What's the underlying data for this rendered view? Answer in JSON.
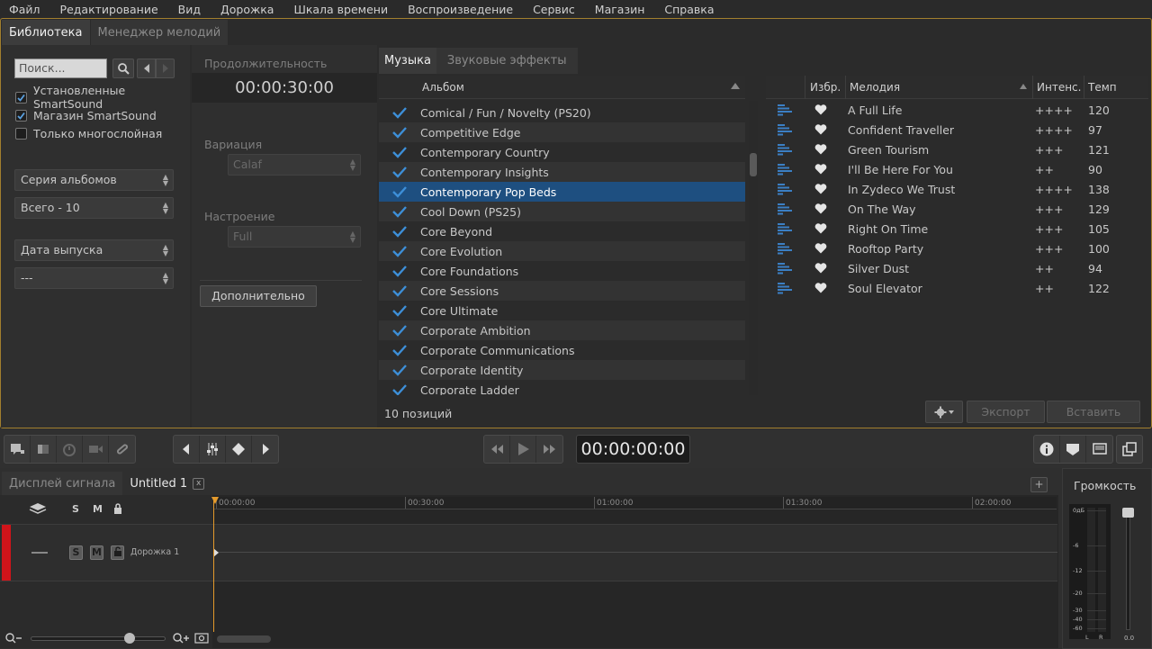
{
  "menu": [
    "Файл",
    "Редактирование",
    "Вид",
    "Дорожка",
    "Шкала времени",
    "Воспроизведение",
    "Сервис",
    "Магазин",
    "Справка"
  ],
  "library_tabs": {
    "library": "Библиотека",
    "melody_manager": "Менеджер мелодий"
  },
  "filters": {
    "search_placeholder": "Поиск...",
    "installed": "Установленные SmartSound",
    "store": "Магазин SmartSound",
    "multilayer_only": "Только многослойная",
    "series": "Серия альбомов",
    "total": "Всего - 10",
    "release_date": "Дата выпуска",
    "dash": "---"
  },
  "details": {
    "duration_label": "Продолжительность",
    "duration_value": "00:00:30:00",
    "variation_label": "Вариация",
    "variation_value": "Calaf",
    "mood_label": "Настроение",
    "mood_value": "Full",
    "more_button": "Дополнительно"
  },
  "music_tabs": {
    "music": "Музыка",
    "sfx": "Звуковые эффекты"
  },
  "album_header": "Альбом",
  "albums": [
    "Comical / Fun / Novelty (PS20)",
    "Competitive Edge",
    "Contemporary Country",
    "Contemporary Insights",
    "Contemporary Pop Beds",
    "Cool Down (PS25)",
    "Core Beyond",
    "Core Evolution",
    "Core Foundations",
    "Core Sessions",
    "Core Ultimate",
    "Corporate Ambition",
    "Corporate Communications",
    "Corporate Identity",
    "Corporate Ladder"
  ],
  "song_header": {
    "fav": "Избр.",
    "melody": "Мелодия",
    "intensity": "Интенс.",
    "tempo": "Темп"
  },
  "songs": [
    {
      "name": "A Full Life",
      "intensity": "++++",
      "tempo": "120"
    },
    {
      "name": "Confident Traveller",
      "intensity": "++++",
      "tempo": "97"
    },
    {
      "name": "Green Tourism",
      "intensity": "+++",
      "tempo": "121"
    },
    {
      "name": "I'll Be Here For You",
      "intensity": "++",
      "tempo": "90"
    },
    {
      "name": "In Zydeco We Trust",
      "intensity": "++++",
      "tempo": "138"
    },
    {
      "name": "On The Way",
      "intensity": "+++",
      "tempo": "129"
    },
    {
      "name": "Right On Time",
      "intensity": "+++",
      "tempo": "105"
    },
    {
      "name": "Rooftop Party",
      "intensity": "+++",
      "tempo": "100"
    },
    {
      "name": "Silver Dust",
      "intensity": "++",
      "tempo": "94"
    },
    {
      "name": "Soul Elevator",
      "intensity": "++",
      "tempo": "122"
    }
  ],
  "list_footer": {
    "count": "10 позиций",
    "export": "Экспорт",
    "insert": "Вставить"
  },
  "transport": {
    "timecode": "00:00:00:00"
  },
  "timeline_tabs": {
    "waveform": "Дисплей сигнала",
    "project": "Untitled 1",
    "close": "x"
  },
  "track_header": {
    "solo": "S",
    "mute": "M"
  },
  "track": {
    "name": "Дорожка 1",
    "solo": "S",
    "mute": "M"
  },
  "ruler": [
    "00:00:00",
    "00:30:00",
    "01:00:00",
    "01:30:00",
    "02:00:00"
  ],
  "volume": {
    "title": "Громкость",
    "scale": [
      "0дБ",
      "-6",
      "-12",
      "-20",
      "-30",
      "-40",
      "-60"
    ],
    "left": "L",
    "right": "R",
    "value": "0.0"
  },
  "add_button": "+"
}
